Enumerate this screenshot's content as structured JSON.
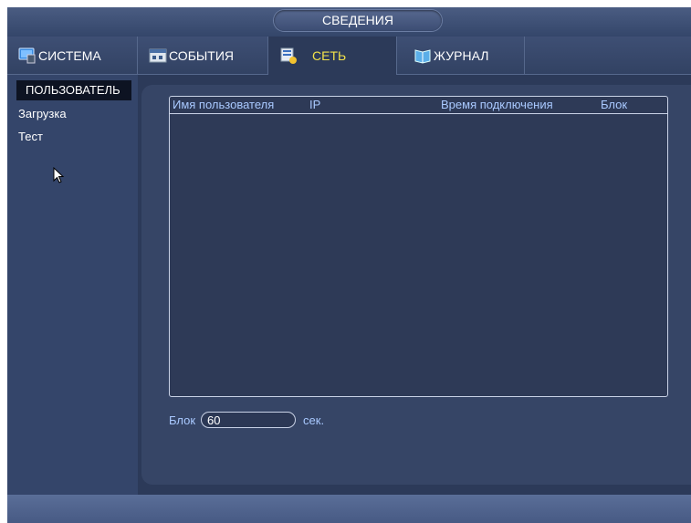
{
  "window": {
    "title": "СВЕДЕНИЯ"
  },
  "tabs": [
    {
      "label": "СИСТЕМА",
      "icon": "monitor-icon"
    },
    {
      "label": "СОБЫТИЯ",
      "icon": "events-icon"
    },
    {
      "label": "СЕТЬ",
      "icon": "network-info-icon",
      "active": true
    },
    {
      "label": "ЖУРНАЛ",
      "icon": "log-book-icon"
    }
  ],
  "sidebar": {
    "items": [
      {
        "label": "ПОЛЬЗОВАТЕЛЬ",
        "selected": true
      },
      {
        "label": "Загрузка"
      },
      {
        "label": "Тест"
      }
    ]
  },
  "users_table": {
    "columns": [
      "Имя пользователя",
      "IP",
      "Время подключения",
      "Блок"
    ],
    "rows": []
  },
  "lock": {
    "label": "Блок",
    "value": "60",
    "unit": "сек."
  },
  "colors": {
    "background": "#2c3a59",
    "panel": "#364566",
    "active_tab_text": "#f2e24a",
    "header_text": "#a9c9ff",
    "selected_item_bg": "#0d1322"
  }
}
